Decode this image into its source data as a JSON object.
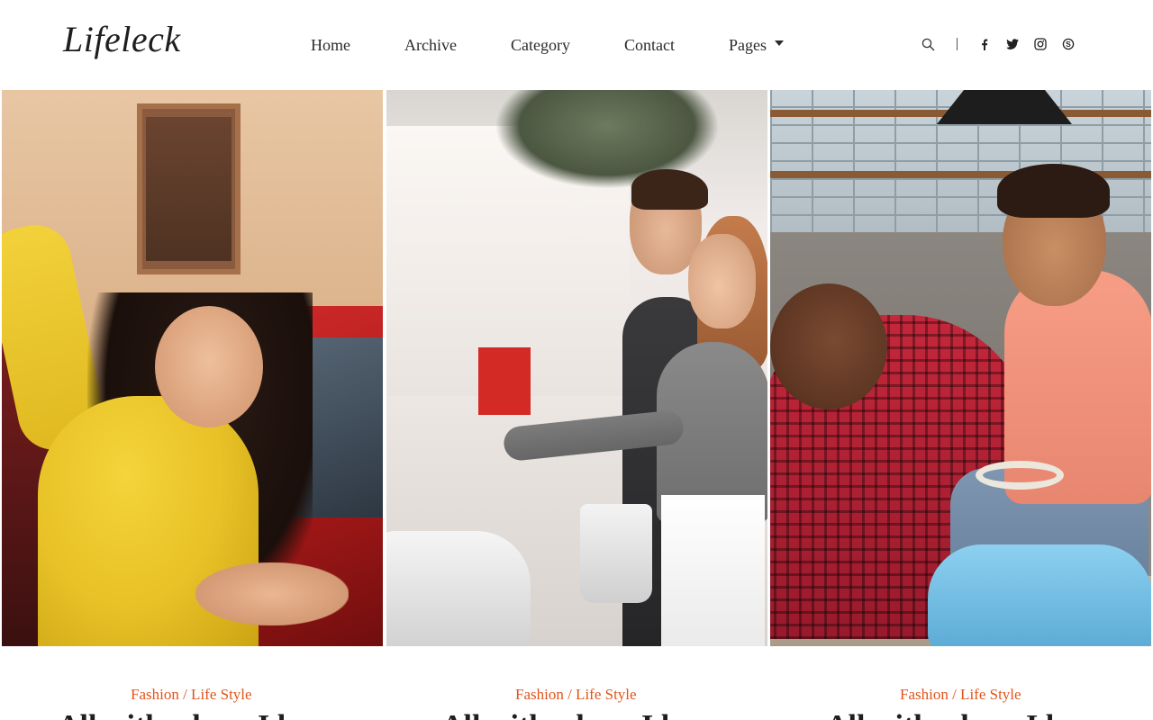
{
  "brand": {
    "logo": "Lifeleck"
  },
  "nav": {
    "items": [
      {
        "label": "Home"
      },
      {
        "label": "Archive"
      },
      {
        "label": "Category"
      },
      {
        "label": "Contact"
      },
      {
        "label": "Pages",
        "has_dropdown": true
      }
    ]
  },
  "toolbar": {
    "icons": [
      "search-icon",
      "facebook-icon",
      "twitter-icon",
      "instagram-icon",
      "skype-icon"
    ]
  },
  "posts": [
    {
      "category": "Fashion / Life Style",
      "title": "All with whom I have",
      "image": "woman-yellow-sweater-red-car"
    },
    {
      "category": "Fashion / Life Style",
      "title": "All with whom I have",
      "image": "couple-car-showroom"
    },
    {
      "category": "Fashion / Life Style",
      "title": "All with whom I have",
      "image": "father-son-toy-car"
    }
  ],
  "colors": {
    "accent": "#e0541a",
    "text": "#222222",
    "background": "#ffffff"
  }
}
